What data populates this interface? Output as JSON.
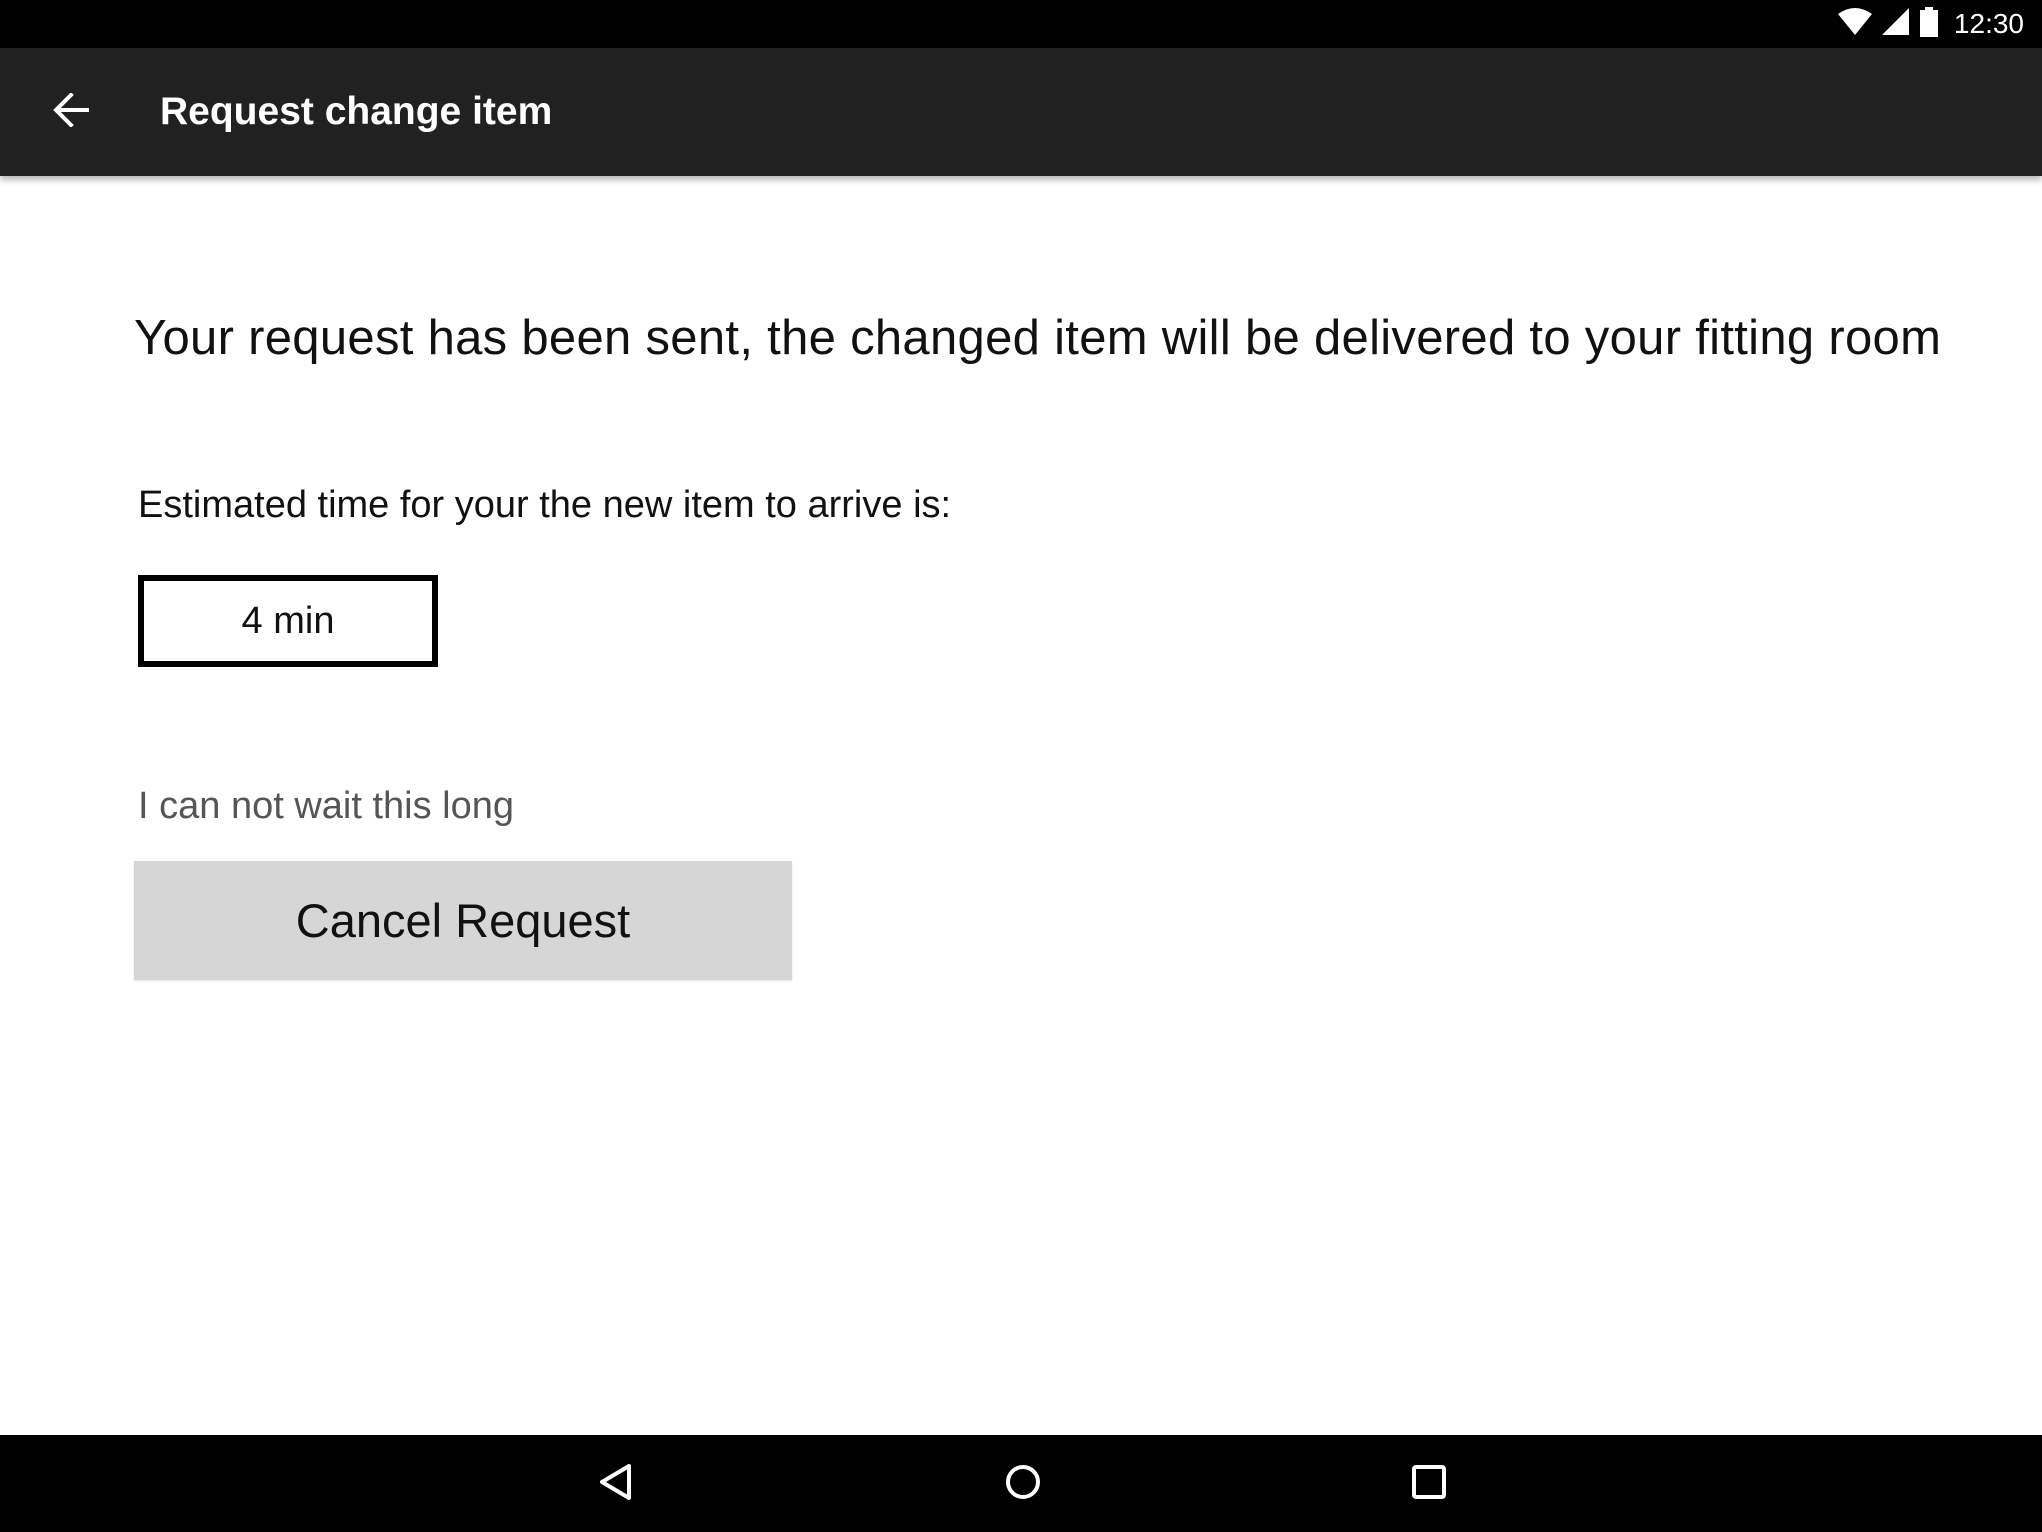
{
  "status_bar": {
    "time": "12:30",
    "icons": [
      "wifi-icon",
      "cell-signal-icon",
      "battery-icon"
    ]
  },
  "app_bar": {
    "title": "Request change item",
    "back_icon": "arrow-back-icon"
  },
  "content": {
    "message": "Your request has been sent, the changed item will be delivered to your fitting room",
    "eta_label": "Estimated time for your the new item to arrive is:",
    "eta_value": "4 min",
    "wait_text": "I can not wait this long",
    "cancel_button_label": "Cancel Request"
  },
  "nav_bar": {
    "icons": [
      "back-triangle-icon",
      "home-circle-icon",
      "recents-square-icon"
    ]
  },
  "colors": {
    "status_bar": "#000000",
    "app_bar": "#212121",
    "background": "#ffffff",
    "button": "#d6d6d6",
    "muted_text": "#555555"
  }
}
